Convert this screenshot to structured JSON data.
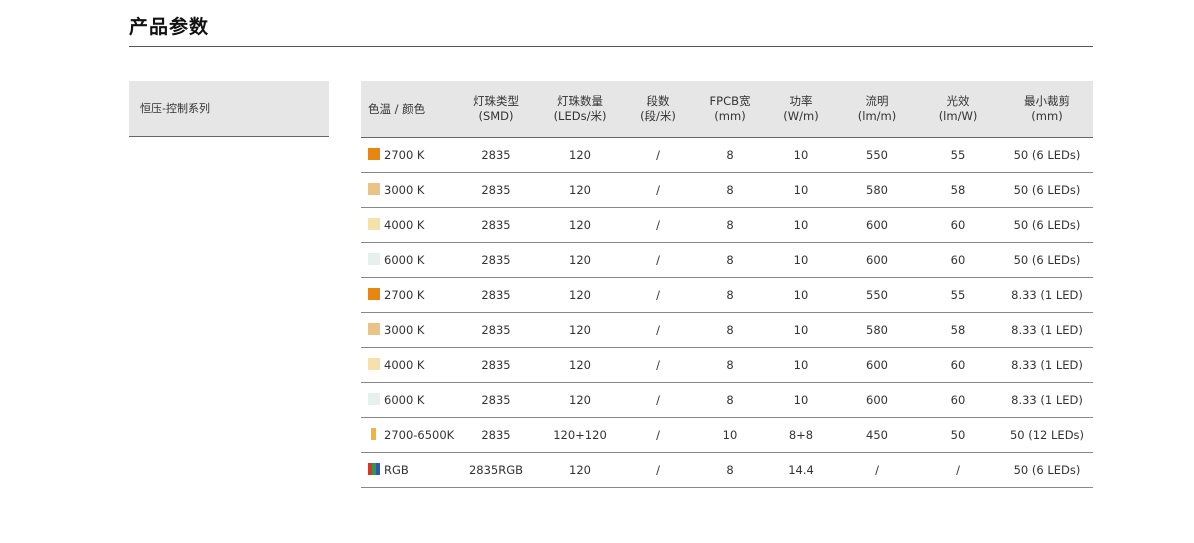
{
  "section": {
    "title": "产品参数"
  },
  "side": {
    "label": "恒压-控制系列"
  },
  "table": {
    "headers": [
      {
        "l1": "色温 / 颜色",
        "l2": ""
      },
      {
        "l1": "灯珠类型",
        "l2": "(SMD)"
      },
      {
        "l1": "灯珠数量",
        "l2": "(LEDs/米)"
      },
      {
        "l1": "段数",
        "l2": "(段/米)"
      },
      {
        "l1": "FPCB宽",
        "l2": "(mm)"
      },
      {
        "l1": "功率",
        "l2": "(W/m)"
      },
      {
        "l1": "流明",
        "l2": "(lm/m)"
      },
      {
        "l1": "光效",
        "l2": "(lm/W)"
      },
      {
        "l1": "最小裁剪",
        "l2": "(mm)"
      }
    ],
    "rows": [
      {
        "swatch": "#e8870f",
        "color": "2700 K",
        "smd": "2835",
        "leds": "120",
        "segments": "/",
        "fpcb": "8",
        "power": "10",
        "lumen": "550",
        "efficacy": "55",
        "cut": "50 (6 LEDs)"
      },
      {
        "swatch": "#e9c486",
        "color": "3000 K",
        "smd": "2835",
        "leds": "120",
        "segments": "/",
        "fpcb": "8",
        "power": "10",
        "lumen": "580",
        "efficacy": "58",
        "cut": "50 (6 LEDs)"
      },
      {
        "swatch": "#f6e1ad",
        "color": "4000 K",
        "smd": "2835",
        "leds": "120",
        "segments": "/",
        "fpcb": "8",
        "power": "10",
        "lumen": "600",
        "efficacy": "60",
        "cut": "50 (6 LEDs)"
      },
      {
        "swatch": "#e8f0ee",
        "color": "6000 K",
        "smd": "2835",
        "leds": "120",
        "segments": "/",
        "fpcb": "8",
        "power": "10",
        "lumen": "600",
        "efficacy": "60",
        "cut": "50 (6 LEDs)"
      },
      {
        "swatch": "#e8870f",
        "color": "2700 K",
        "smd": "2835",
        "leds": "120",
        "segments": "/",
        "fpcb": "8",
        "power": "10",
        "lumen": "550",
        "efficacy": "55",
        "cut": "8.33 (1 LED)"
      },
      {
        "swatch": "#e9c486",
        "color": "3000 K",
        "smd": "2835",
        "leds": "120",
        "segments": "/",
        "fpcb": "8",
        "power": "10",
        "lumen": "580",
        "efficacy": "58",
        "cut": "8.33 (1 LED)"
      },
      {
        "swatch": "#f6e1ad",
        "color": "4000 K",
        "smd": "2835",
        "leds": "120",
        "segments": "/",
        "fpcb": "8",
        "power": "10",
        "lumen": "600",
        "efficacy": "60",
        "cut": "8.33 (1 LED)"
      },
      {
        "swatch": "#e8f0ee",
        "color": "6000 K",
        "smd": "2835",
        "leds": "120",
        "segments": "/",
        "fpcb": "8",
        "power": "10",
        "lumen": "600",
        "efficacy": "60",
        "cut": "8.33 (1 LED)"
      },
      {
        "swatch": "#f3b43a",
        "swatch_style": "thin",
        "color": "2700-6500K",
        "smd": "2835",
        "leds": "120+120",
        "segments": "/",
        "fpcb": "10",
        "power": "8+8",
        "lumen": "450",
        "efficacy": "50",
        "cut": "50 (12 LEDs)"
      },
      {
        "swatch": "rgb",
        "color": "RGB",
        "smd": "2835RGB",
        "leds": "120",
        "segments": "/",
        "fpcb": "8",
        "power": "14.4",
        "lumen": "/",
        "efficacy": "/",
        "cut": "50 (6 LEDs)"
      }
    ]
  },
  "colors": {
    "header_bg": "#e6e6e6",
    "rgb_swatch": [
      "#d8342b",
      "#2f9b3c",
      "#2f55b5"
    ]
  }
}
